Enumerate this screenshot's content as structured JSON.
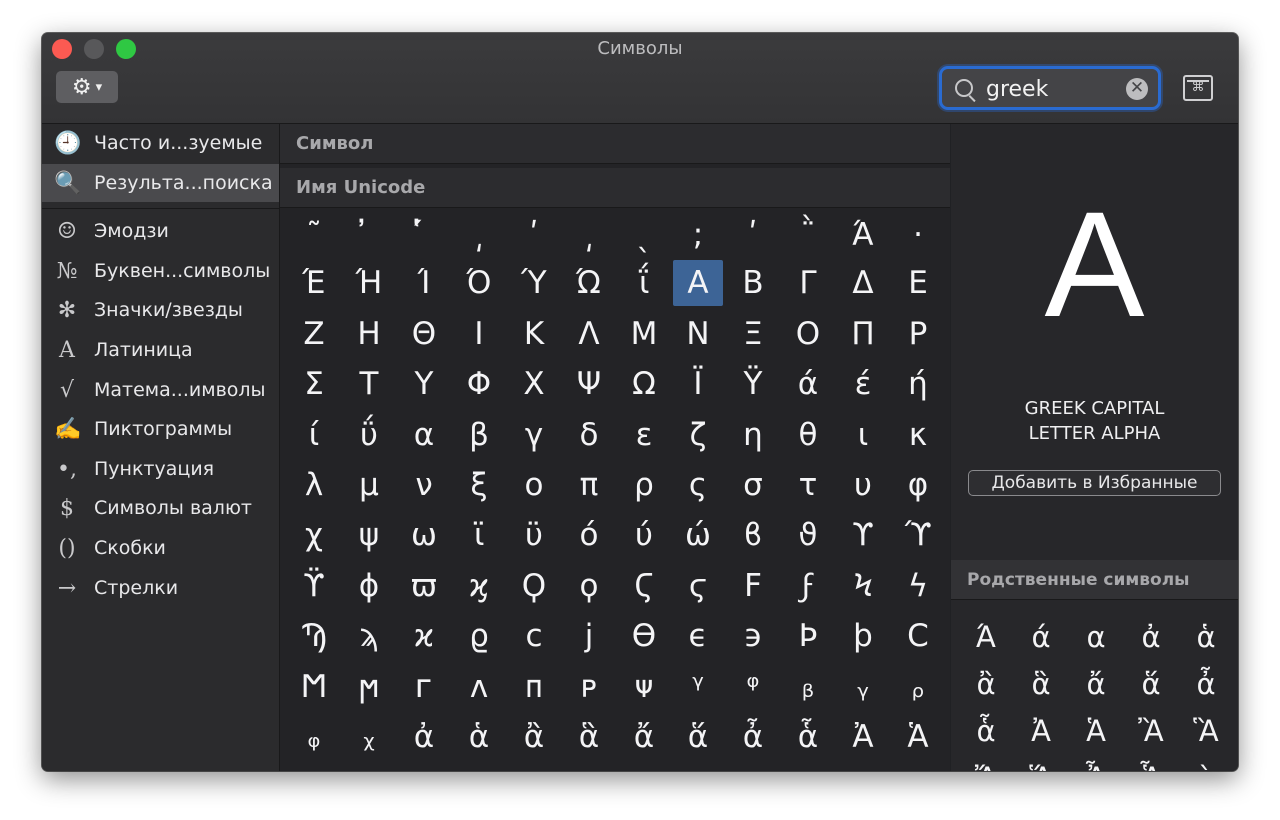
{
  "window": {
    "title": "Символы"
  },
  "toolbar": {
    "gear_icon": "⚙",
    "chevron_icon": "⌄",
    "keyboard_icon": "⌘"
  },
  "search": {
    "value": "greek",
    "clear_icon": "✕"
  },
  "sidebar": {
    "items": [
      {
        "icon": "🕘",
        "label": "Часто и...зуемые",
        "selected": false
      },
      {
        "icon": "🔍",
        "label": "Результа...поиска",
        "selected": true
      },
      {
        "icon": "☺",
        "label": "Эмодзи",
        "selected": false
      },
      {
        "icon": "№",
        "label": "Буквен...символы",
        "selected": false
      },
      {
        "icon": "✻",
        "label": "Значки/звезды",
        "selected": false
      },
      {
        "icon": "A",
        "label": "Латиница",
        "selected": false
      },
      {
        "icon": "√",
        "label": "Матема...имволы",
        "selected": false
      },
      {
        "icon": "✍",
        "label": "Пиктограммы",
        "selected": false
      },
      {
        "icon": "•,",
        "label": "Пунктуация",
        "selected": false
      },
      {
        "icon": "$",
        "label": "Символы валют",
        "selected": false
      },
      {
        "icon": "()",
        "label": "Скобки",
        "selected": false
      },
      {
        "icon": "→",
        "label": "Стрелки",
        "selected": false
      }
    ]
  },
  "columns": {
    "symbol": "Символ",
    "unicode_name": "Имя Unicode"
  },
  "grid": {
    "rows": [
      [
        "˜",
        "̓",
        "̔́",
        "͵",
        "ʹ",
        "͵",
        "ˎ",
        ";",
        "ʹ",
        "῭",
        "Ά",
        "·"
      ],
      [
        "Έ",
        "Ή",
        "Ί",
        "Ό",
        "Ύ",
        "Ώ",
        "ΐ",
        "Α",
        "Β",
        "Γ",
        "Δ",
        "Ε"
      ],
      [
        "Ζ",
        "Η",
        "Θ",
        "Ι",
        "Κ",
        "Λ",
        "Μ",
        "Ν",
        "Ξ",
        "Ο",
        "Π",
        "Ρ"
      ],
      [
        "Σ",
        "Τ",
        "Υ",
        "Φ",
        "Χ",
        "Ψ",
        "Ω",
        "Ϊ",
        "Ϋ",
        "ά",
        "έ",
        "ή"
      ],
      [
        "ί",
        "ΰ",
        "α",
        "β",
        "γ",
        "δ",
        "ε",
        "ζ",
        "η",
        "θ",
        "ι",
        "κ"
      ],
      [
        "λ",
        "μ",
        "ν",
        "ξ",
        "ο",
        "π",
        "ρ",
        "ς",
        "σ",
        "τ",
        "υ",
        "φ"
      ],
      [
        "χ",
        "ψ",
        "ω",
        "ϊ",
        "ϋ",
        "ό",
        "ύ",
        "ώ",
        "ϐ",
        "ϑ",
        "ϒ",
        "ϓ"
      ],
      [
        "ϔ",
        "ϕ",
        "ϖ",
        "ϗ",
        "Ϙ",
        "ϙ",
        "Ϛ",
        "ϛ",
        "Ϝ",
        "ϝ",
        "Ϟ",
        "ϟ"
      ],
      [
        "Ϡ",
        "ϡ",
        "ϰ",
        "ϱ",
        "ϲ",
        "ϳ",
        "ϴ",
        "ϵ",
        "϶",
        "Ϸ",
        "ϸ",
        "Ϲ"
      ],
      [
        "Ϻ",
        "ϻ",
        "ᴦ",
        "ᴧ",
        "ᴨ",
        "ᴩ",
        "ᴪ",
        "ᵞ",
        "ᵠ",
        "ᵦ",
        "ᵧ",
        "ᵨ"
      ],
      [
        "ᵩ",
        "ᵪ",
        "ἀ",
        "ἁ",
        "ἂ",
        "ἃ",
        "ἄ",
        "ἅ",
        "ἆ",
        "ἇ",
        "Ἀ",
        "Ἁ"
      ]
    ],
    "selected_row": 1,
    "selected_col": 7
  },
  "detail": {
    "glyph": "Α",
    "name_line1": "GREEK CAPITAL",
    "name_line2": "LETTER ALPHA",
    "add_favorite_label": "Добавить в Избранные",
    "related_header": "Родственные символы",
    "related": [
      [
        "Ά",
        "ά",
        "α",
        "ἀ",
        "ἁ"
      ],
      [
        "ἂ",
        "ἃ",
        "ἄ",
        "ἅ",
        "ἆ"
      ],
      [
        "ἇ",
        "Ἀ",
        "Ἁ",
        "Ἂ",
        "Ἃ"
      ],
      [
        "Ἄ",
        "Ἅ",
        "Ἆ",
        "Ἇ",
        "ὰ"
      ]
    ]
  },
  "colors": {
    "accent": "#2a6bd1",
    "selection": "#3d6496",
    "close": "#fc5a52",
    "maximize": "#2fc843"
  }
}
